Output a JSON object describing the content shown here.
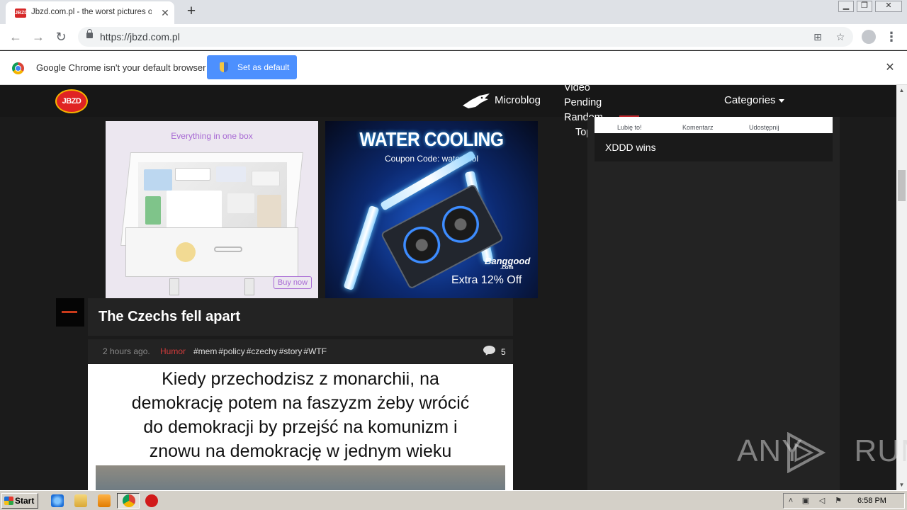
{
  "browser": {
    "tab_title": "Jbzd.com.pl - the worst pictures on the",
    "tab_favicon": "JBZD",
    "new_tab_icon": "+",
    "url": "https://jbzd.com.pl",
    "window_controls": {
      "minimize": "▁",
      "restore": "❐",
      "close": "✕"
    }
  },
  "infobar": {
    "message": "Google Chrome isn't your default browser",
    "button_label": "Set as default",
    "close": "✕"
  },
  "site": {
    "logo": "JBZD",
    "nav": {
      "microblog": "Microblog",
      "stack": [
        "Video",
        "Pending",
        "Random",
        "Top"
      ],
      "categories": "Categories"
    },
    "ads": {
      "ad1_text": "Everything in one box",
      "ad1_button": "Buy now",
      "ad2_title": "WATER COOLING",
      "ad2_code": "Coupon Code: watercool",
      "ad2_brand": "Banggood",
      "ad2_brand_sub": ".com",
      "ad2_extra": "Extra 12% Off"
    },
    "post": {
      "title": "The Czechs fell apart",
      "time": "2 hours ago.",
      "category": "Humor",
      "tags": [
        "#mem",
        "#policy",
        "#czechy",
        "#story",
        "#WTF"
      ],
      "comments": "5",
      "meme_lines": [
        "Kiedy przechodzisz z monarchii, na",
        "demokrację potem na faszyzm żeby wrócić",
        "do demokracji by przejść na komunizm i",
        "znowu na demokrację w jednym wieku"
      ]
    },
    "sidebar": {
      "fb_like": "Lubię to!",
      "fb_comment": "Komentarz",
      "fb_share": "Udostępnij",
      "card_text": "XDDD wins"
    }
  },
  "watermark": {
    "left": "ANY",
    "right": "RUN"
  },
  "taskbar": {
    "start": "Start",
    "clock": "6:58 PM"
  }
}
